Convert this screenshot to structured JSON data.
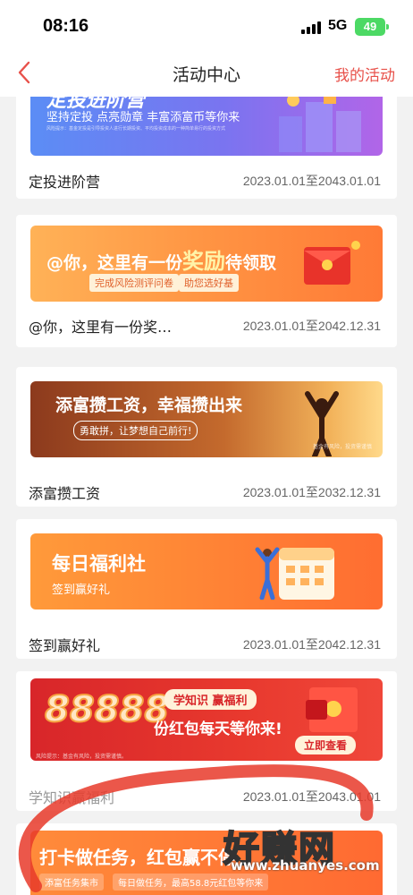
{
  "status": {
    "time": "08:16",
    "network": "5G",
    "battery": "49"
  },
  "nav": {
    "title": "活动中心",
    "my_activities": "我的活动"
  },
  "cards": [
    {
      "banner_title": "定投进阶营",
      "banner_sub": "坚持定投 点亮勋章 丰富添富币等你来",
      "name": "定投进阶营",
      "date": "2023.01.01至2043.01.01"
    },
    {
      "banner_title_a": "@你，这里有一份",
      "banner_title_b": "奖励",
      "banner_title_c": "待领取",
      "pill_a": "完成风险测评问卷",
      "pill_b": "助您选好基",
      "name": "@你，这里有一份奖…",
      "date": "2023.01.01至2042.12.31"
    },
    {
      "banner_title": "添富攒工资，幸福攒出来",
      "banner_sub": "勇敢拼，让梦想自己前行!",
      "banner_note": "基金有风险，投资需谨慎",
      "name": "添富攒工资",
      "date": "2023.01.01至2032.12.31"
    },
    {
      "banner_title": "每日福利社",
      "banner_sub": "签到赢好礼",
      "name": "签到赢好礼",
      "date": "2023.01.01至2042.12.31"
    },
    {
      "banner_num": "88888",
      "banner_tag": "学知识 赢福利",
      "banner_title": "份红包每天等你来!",
      "banner_btn": "立即查看",
      "banner_note": "风险提示：基金有风险，投资需谨慎。",
      "name": "学知识赢福利",
      "date": "2023.01.01至2043.01.01"
    },
    {
      "banner_title": "打卡做任务，红包赢不停",
      "banner_tag": "添富任务集市",
      "banner_sub": "每日做任务，最高58.8元红包等你来"
    }
  ],
  "watermark": {
    "text": "好赚网",
    "url": "www.zhuanyes.com"
  },
  "colors": {
    "accent": "#e8514a",
    "orange": "#ff8a3d",
    "red": "#d8262a",
    "purple": "#7b6cf0"
  }
}
